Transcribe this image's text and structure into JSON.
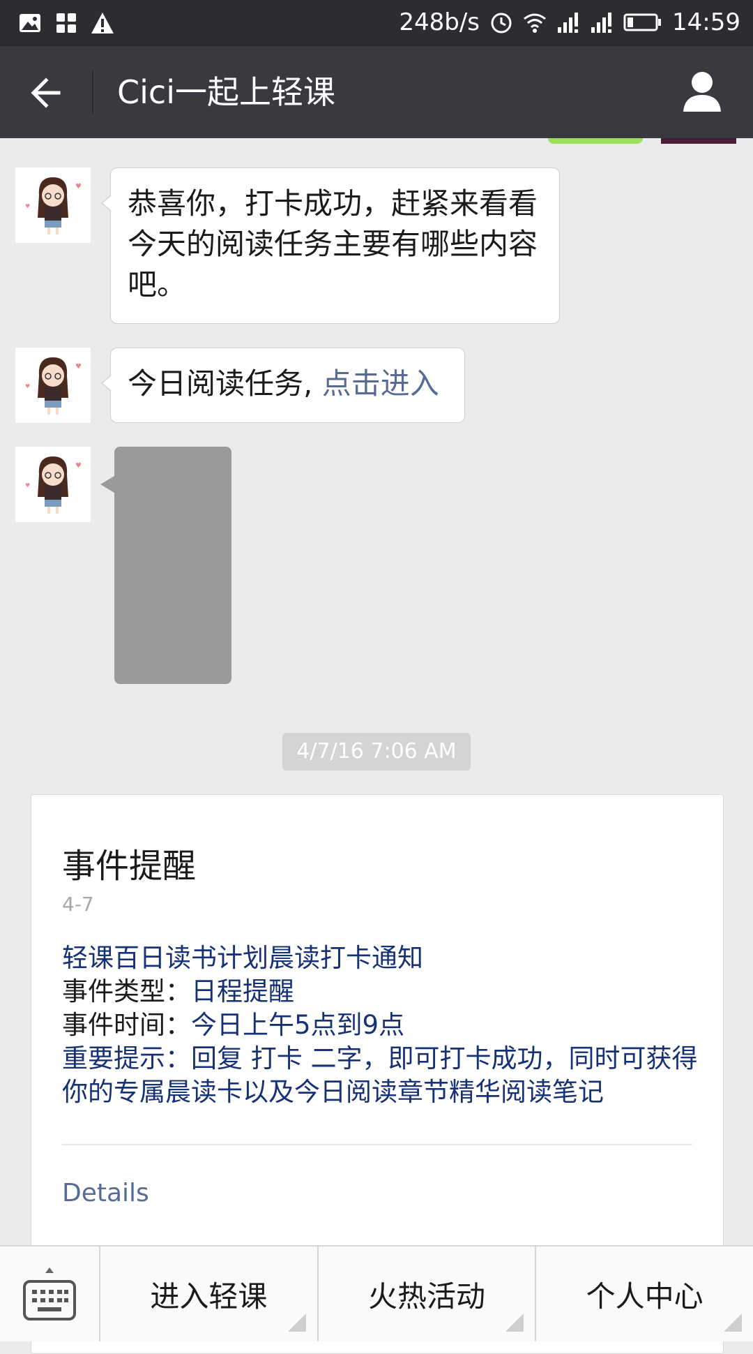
{
  "status_bar": {
    "net_speed": "248b/s",
    "time": "14:59",
    "icons": [
      "image-icon",
      "grid-icon",
      "warning-icon",
      "alarm-icon",
      "wifi-icon",
      "signal-icon",
      "signal-icon",
      "battery-icon"
    ]
  },
  "header": {
    "title": "Cici一起上轻课",
    "back_icon": "back-arrow-icon",
    "profile_icon": "user-icon"
  },
  "messages": [
    {
      "text": "恭喜你，打卡成功，赶紧来看看今天的阅读任务主要有哪些内容吧。"
    },
    {
      "text": "今日阅读任务, ",
      "link": "点击进入"
    },
    {
      "type": "image"
    }
  ],
  "timestamp": "4/7/16 7:06 AM",
  "card": {
    "title": "事件提醒",
    "date": "4-7",
    "line1": "轻课百日读书计划晨读打卡通知",
    "type_label": "事件类型：",
    "type_value": "日程提醒",
    "time_label": "事件时间：",
    "time_value": "今日上午5点到9点",
    "tip": "重要提示：回复 打卡 二字，即可打卡成功，同时可获得你的专属晨读卡以及今日阅读章节精华阅读笔记",
    "details": "Details"
  },
  "bottom_menu": {
    "keyboard_icon": "keyboard-icon",
    "items": [
      "进入轻课",
      "火热活动",
      "个人中心"
    ]
  },
  "colors": {
    "status_bar": "#2b2d31",
    "title_bar": "#393a3f",
    "background": "#ebebeb",
    "link": "#576b95",
    "card_text_blue": "#173177"
  }
}
